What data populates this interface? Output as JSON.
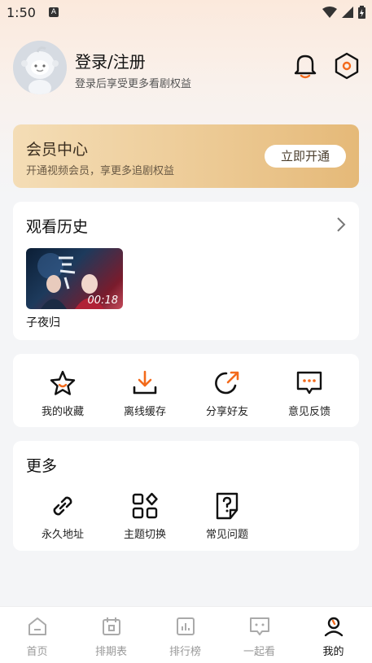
{
  "status": {
    "time": "1:50",
    "a_icon": "A"
  },
  "profile": {
    "title": "登录/注册",
    "subtitle": "登录后享受更多看剧权益"
  },
  "vip": {
    "title": "会员中心",
    "subtitle": "开通视频会员，享更多追剧权益",
    "button": "立即开通"
  },
  "history": {
    "title": "观看历史",
    "items": [
      {
        "name": "子夜归",
        "time": "00:18"
      }
    ]
  },
  "actions": [
    {
      "label": "我的收藏",
      "icon": "star-icon"
    },
    {
      "label": "离线缓存",
      "icon": "download-icon"
    },
    {
      "label": "分享好友",
      "icon": "share-icon"
    },
    {
      "label": "意见反馈",
      "icon": "feedback-icon"
    }
  ],
  "more": {
    "title": "更多",
    "items": [
      {
        "label": "永久地址",
        "icon": "link-icon"
      },
      {
        "label": "主题切换",
        "icon": "theme-icon"
      },
      {
        "label": "常见问题",
        "icon": "faq-icon"
      }
    ]
  },
  "tabs": [
    {
      "label": "首页",
      "icon": "home-icon"
    },
    {
      "label": "排期表",
      "icon": "calendar-icon"
    },
    {
      "label": "排行榜",
      "icon": "ranking-icon"
    },
    {
      "label": "一起看",
      "icon": "watch-together-icon"
    },
    {
      "label": "我的",
      "icon": "profile-icon",
      "active": true
    }
  ],
  "colors": {
    "accent": "#f36a1b",
    "vip_gold": "#ecc993"
  }
}
